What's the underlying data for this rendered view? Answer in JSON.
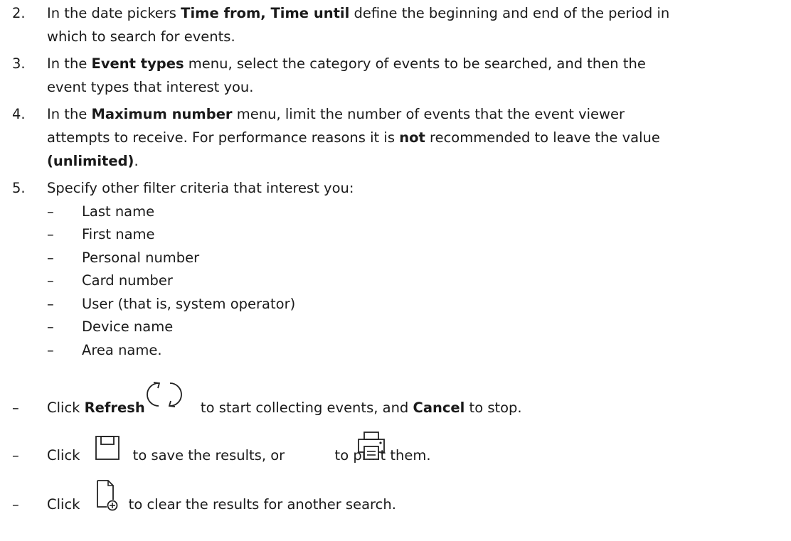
{
  "steps": [
    {
      "num": "2.",
      "line1_pre": "In the date pickers ",
      "line1_bold": "Time from, Time until",
      "line1_post": " define the beginning and end of the period in",
      "line2": "which to search for events."
    },
    {
      "num": "3.",
      "line1_pre": "In the ",
      "line1_bold": "Event types",
      "line1_post": " menu, select the category of events to be searched, and then the",
      "line2": "event types that interest you."
    },
    {
      "num": "4.",
      "line1_pre": "In the ",
      "line1_bold": "Maximum number",
      "line1_post": " menu, limit the number of events that the event viewer",
      "line2_pre": "attempts to receive. For performance reasons it is ",
      "line2_bold": "not",
      "line2_post": " recommended to leave the value",
      "line3_bold": "(unlimited)",
      "line3_post": "."
    },
    {
      "num": "5.",
      "line1": "Specify other filter criteria that interest you:"
    }
  ],
  "dash": "–",
  "criteria": [
    "Last name",
    "First name",
    "Personal number",
    "Card number",
    "User (that is, system operator)",
    "Device name",
    "Area name."
  ],
  "actions": {
    "refresh_pre": "Click ",
    "refresh_bold": "Refresh",
    "refresh_post": " to start collecting events, and ",
    "cancel_bold": "Cancel",
    "cancel_post": " to stop.",
    "save_pre": "Click",
    "save_mid": " to save the results, or ",
    "print_post": " to print them.",
    "clear_pre": "Click",
    "clear_post": " to clear the results for another search."
  },
  "icons": {
    "refresh": "refresh-icon",
    "save": "save-icon",
    "print": "print-icon",
    "new": "new-document-icon"
  }
}
